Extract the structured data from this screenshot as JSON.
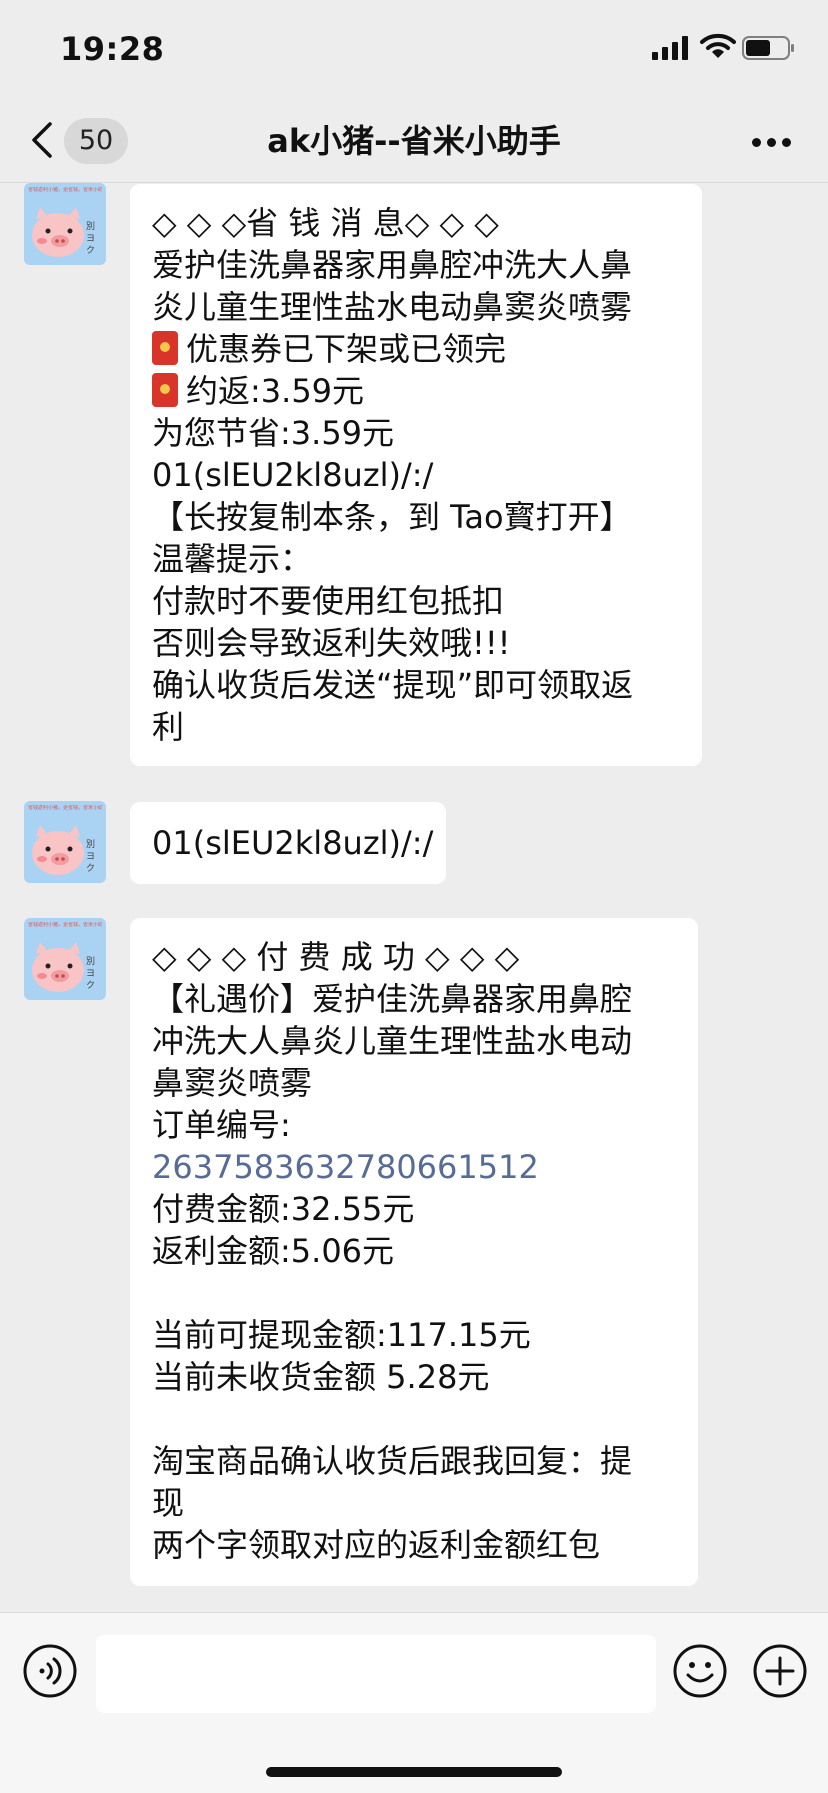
{
  "status_bar": {
    "time": "19:28"
  },
  "nav": {
    "back_count": "50",
    "title": "ak小猪--省米小助手"
  },
  "avatar": {
    "tiny_text": "省钱返利小猪，更省钱，省米小助手"
  },
  "messages": [
    {
      "lines": [
        "◇ ◇ ◇省 钱 消 息◇ ◇ ◇",
        "爱护佳洗鼻器家用鼻腔冲洗大人鼻",
        "炎儿童生理性盐水电动鼻窦炎喷雾",
        "优惠券已下架或已领完",
        "约返:3.59元",
        "为您节省:3.59元",
        "01(slEU2kl8uzl)/:/",
        "【长按复制本条，到 Tao寳打开】",
        "温馨提示：",
        "付款时不要使用红包抵扣",
        "否则会导致返利失效哦!!!",
        "确认收货后发送“提现”即可领取返",
        "利"
      ]
    },
    {
      "lines": [
        "01(slEU2kl8uzl)/:/"
      ]
    },
    {
      "lines": [
        "◇ ◇ ◇ 付 费 成 功 ◇ ◇ ◇",
        "【礼遇价】爱护佳洗鼻器家用鼻腔",
        "冲洗大人鼻炎儿童生理性盐水电动",
        "鼻窦炎喷雾",
        "订单编号:",
        "2637583632780661512",
        "付费金额:32.55元",
        "返利金额:5.06元",
        "",
        "当前可提现金额:117.15元",
        "当前未收货金额 5.28元",
        "",
        "淘宝商品确认收货后跟我回复：提",
        "现",
        "两个字领取对应的返利金额红包"
      ]
    }
  ],
  "input": {
    "value": "",
    "placeholder": ""
  },
  "icons": {
    "back": "chevron-left-icon",
    "more": "more-dots-icon",
    "voice": "voice-icon",
    "emoji": "emoji-icon",
    "plus": "plus-icon",
    "red_packet": "red-packet-icon"
  },
  "colors": {
    "background": "#ededed",
    "bubble": "#ffffff",
    "link": "#576b95",
    "avatar_bg": "#a9d2f3"
  }
}
